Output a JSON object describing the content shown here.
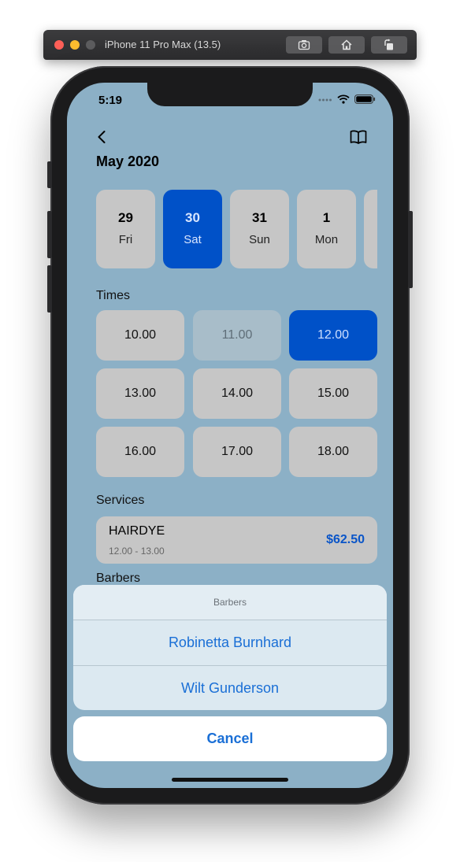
{
  "simulator": {
    "title": "iPhone 11 Pro Max (13.5)",
    "buttons": [
      "screenshot-icon",
      "home-icon",
      "rotate-icon"
    ]
  },
  "status_bar": {
    "time": "5:19"
  },
  "header": {
    "month": "May 2020"
  },
  "dates": [
    {
      "num": "29",
      "day": "Fri",
      "selected": false
    },
    {
      "num": "30",
      "day": "Sat",
      "selected": true
    },
    {
      "num": "31",
      "day": "Sun",
      "selected": false
    },
    {
      "num": "1",
      "day": "Mon",
      "selected": false
    }
  ],
  "times": {
    "label": "Times",
    "slots": [
      {
        "label": "10.00",
        "state": "normal"
      },
      {
        "label": "11.00",
        "state": "disabled"
      },
      {
        "label": "12.00",
        "state": "selected"
      },
      {
        "label": "13.00",
        "state": "normal"
      },
      {
        "label": "14.00",
        "state": "normal"
      },
      {
        "label": "15.00",
        "state": "normal"
      },
      {
        "label": "16.00",
        "state": "normal"
      },
      {
        "label": "17.00",
        "state": "normal"
      },
      {
        "label": "18.00",
        "state": "normal"
      }
    ]
  },
  "services": {
    "label": "Services",
    "item": {
      "name": "HAIRDYE",
      "time": "12.00 - 13.00",
      "price": "$62.50"
    }
  },
  "barbers": {
    "label": "Barbers"
  },
  "action_sheet": {
    "title": "Barbers",
    "options": [
      "Robinetta Burnhard",
      "Wilt Gunderson"
    ],
    "cancel": "Cancel"
  },
  "colors": {
    "background": "#8cb0c6",
    "accent": "#0051c8",
    "card": "#c6c6c6",
    "action_text": "#1a6fd6"
  }
}
